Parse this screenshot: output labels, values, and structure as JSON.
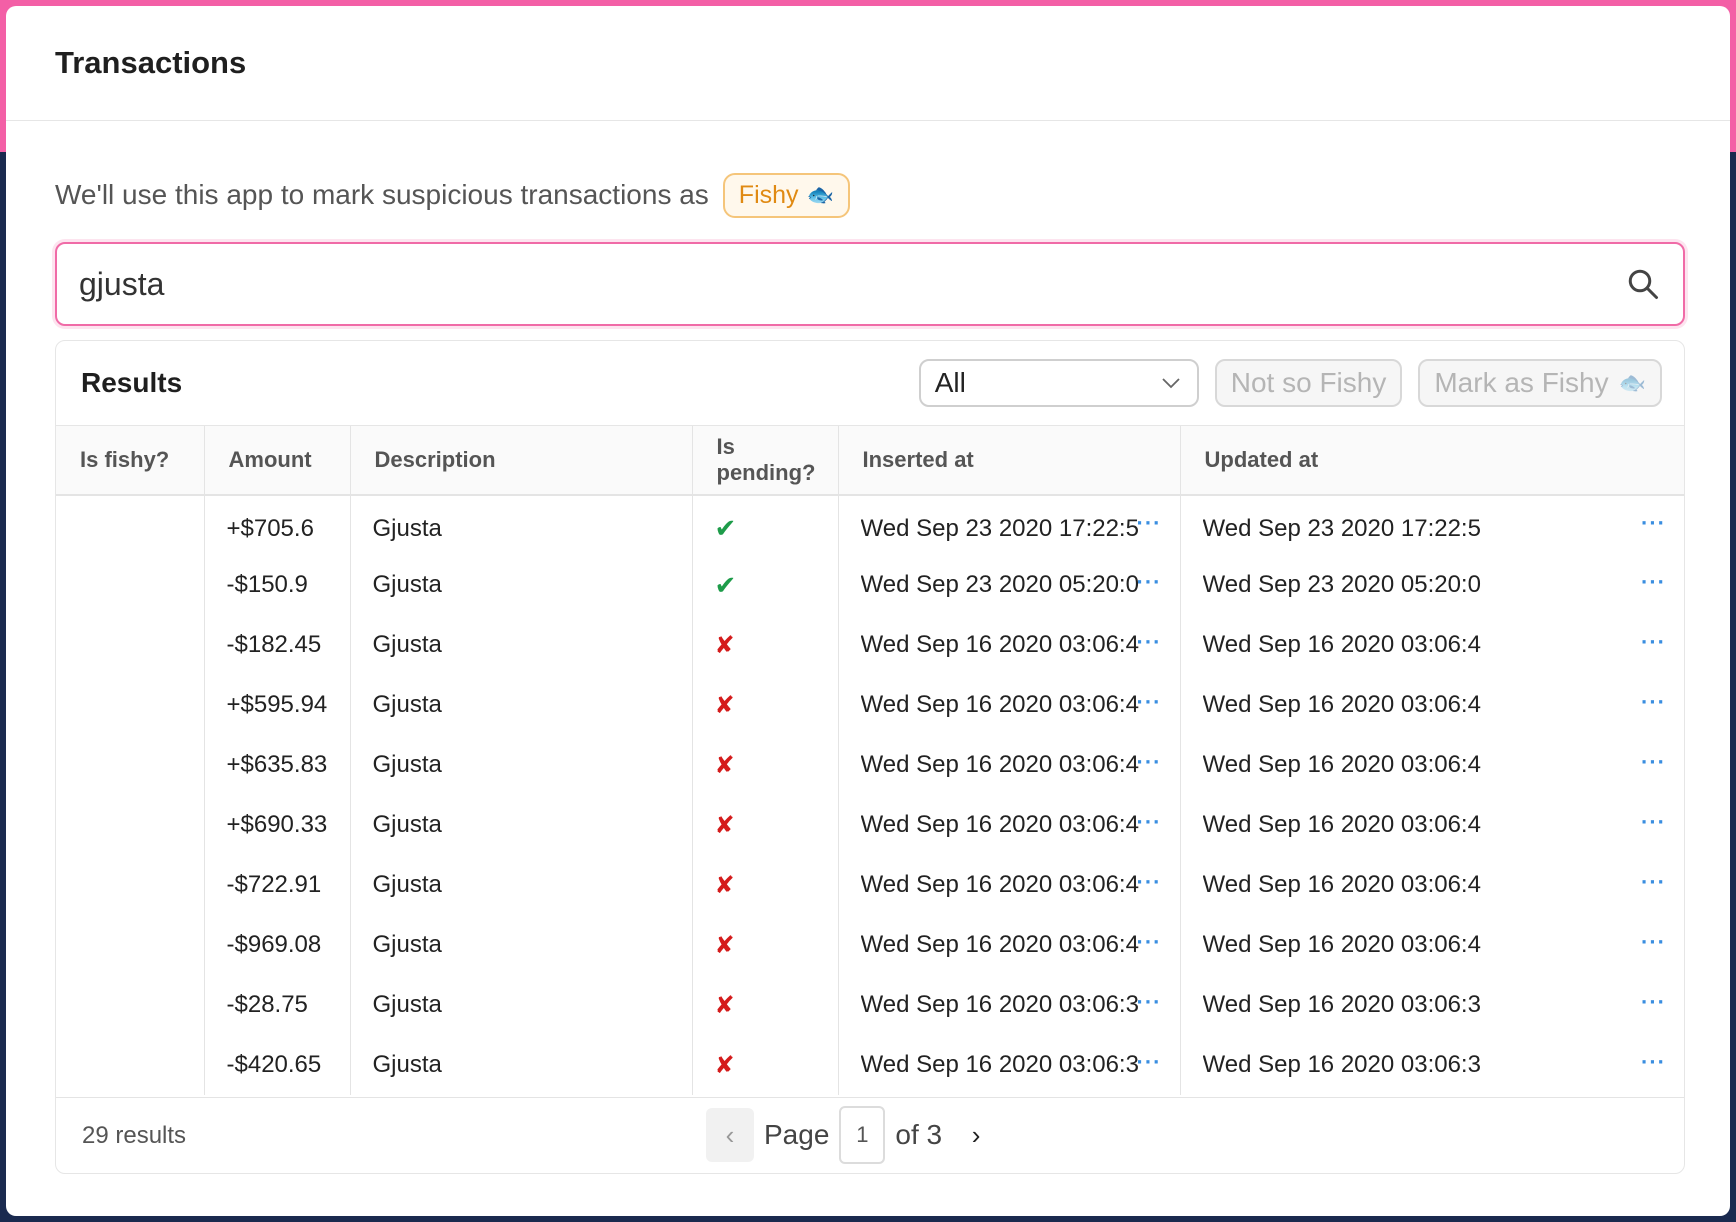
{
  "app": {
    "title": "Transactions"
  },
  "intro": {
    "text": "We'll use this app to mark suspicious transactions as",
    "badge_label": "Fishy"
  },
  "search": {
    "value": "gjusta"
  },
  "results": {
    "title": "Results",
    "filter_value": "All",
    "not_fishy_label": "Not so Fishy",
    "mark_fishy_label": "Mark as Fishy",
    "columns": [
      "Is fishy?",
      "Amount",
      "Description",
      "Is pending?",
      "Inserted at",
      "Updated at"
    ],
    "rows": [
      {
        "fishy": "",
        "amount": "+$705.6",
        "description": "Gjusta",
        "pending": true,
        "inserted": "Wed Sep 23 2020 17:22:5",
        "updated": "Wed Sep 23 2020 17:22:5"
      },
      {
        "fishy": "",
        "amount": "-$150.9",
        "description": "Gjusta",
        "pending": true,
        "inserted": "Wed Sep 23 2020 05:20:0",
        "updated": "Wed Sep 23 2020 05:20:0"
      },
      {
        "fishy": "",
        "amount": "-$182.45",
        "description": "Gjusta",
        "pending": false,
        "inserted": "Wed Sep 16 2020 03:06:4",
        "updated": "Wed Sep 16 2020 03:06:4"
      },
      {
        "fishy": "",
        "amount": "+$595.94",
        "description": "Gjusta",
        "pending": false,
        "inserted": "Wed Sep 16 2020 03:06:4",
        "updated": "Wed Sep 16 2020 03:06:4"
      },
      {
        "fishy": "",
        "amount": "+$635.83",
        "description": "Gjusta",
        "pending": false,
        "inserted": "Wed Sep 16 2020 03:06:4",
        "updated": "Wed Sep 16 2020 03:06:4"
      },
      {
        "fishy": "",
        "amount": "+$690.33",
        "description": "Gjusta",
        "pending": false,
        "inserted": "Wed Sep 16 2020 03:06:4",
        "updated": "Wed Sep 16 2020 03:06:4"
      },
      {
        "fishy": "",
        "amount": "-$722.91",
        "description": "Gjusta",
        "pending": false,
        "inserted": "Wed Sep 16 2020 03:06:4",
        "updated": "Wed Sep 16 2020 03:06:4"
      },
      {
        "fishy": "",
        "amount": "-$969.08",
        "description": "Gjusta",
        "pending": false,
        "inserted": "Wed Sep 16 2020 03:06:4",
        "updated": "Wed Sep 16 2020 03:06:4"
      },
      {
        "fishy": "",
        "amount": "-$28.75",
        "description": "Gjusta",
        "pending": false,
        "inserted": "Wed Sep 16 2020 03:06:3",
        "updated": "Wed Sep 16 2020 03:06:3"
      },
      {
        "fishy": "",
        "amount": "-$420.65",
        "description": "Gjusta",
        "pending": false,
        "inserted": "Wed Sep 16 2020 03:06:3",
        "updated": "Wed Sep 16 2020 03:06:3"
      }
    ],
    "count_text": "29 results",
    "pagination": {
      "page_label": "Page",
      "current": "1",
      "of_label": "of 3"
    }
  },
  "icons": {
    "pending_true": "check-icon",
    "pending_false": "cross-icon",
    "row_menu": "more-icon",
    "fish": "fish-icon"
  },
  "colors": {
    "accent": "#f06ba7",
    "badge": "#e08a13",
    "check": "#1e9c4a",
    "cross": "#d41b1b",
    "link": "#3a8ee0"
  }
}
